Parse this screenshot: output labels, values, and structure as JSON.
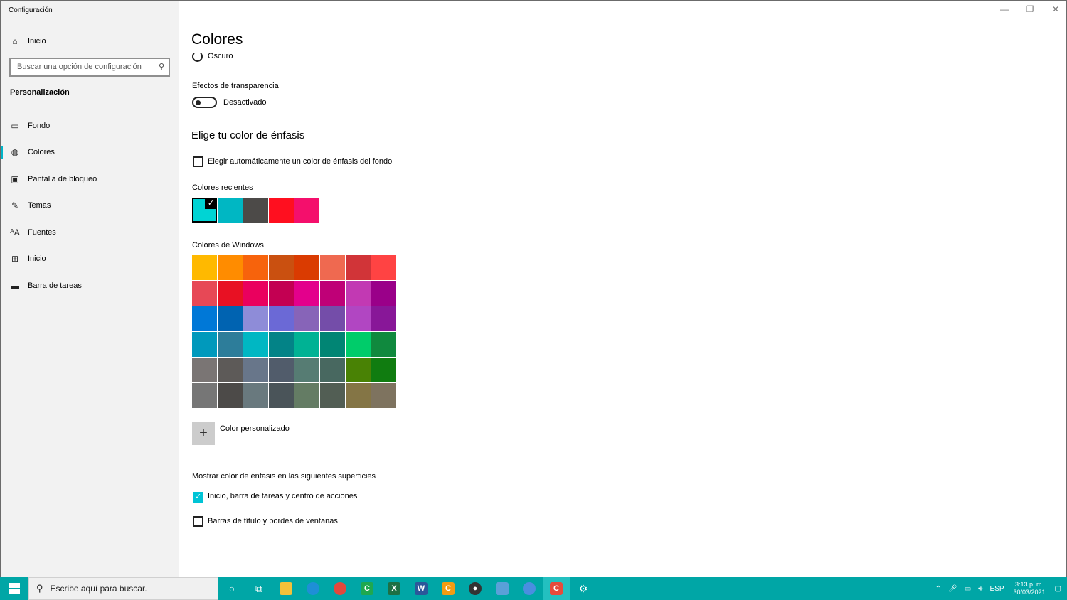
{
  "window": {
    "title": "Configuración"
  },
  "sidebar": {
    "home_label": "Inicio",
    "search_placeholder": "Buscar una opción de configuración",
    "section_title": "Personalización",
    "items": [
      {
        "label": "Fondo",
        "icon": "image-icon"
      },
      {
        "label": "Colores",
        "icon": "palette-icon",
        "selected": true
      },
      {
        "label": "Pantalla de bloqueo",
        "icon": "lock-screen-icon"
      },
      {
        "label": "Temas",
        "icon": "themes-icon"
      },
      {
        "label": "Fuentes",
        "icon": "fonts-icon"
      },
      {
        "label": "Inicio",
        "icon": "start-icon"
      },
      {
        "label": "Barra de tareas",
        "icon": "taskbar-icon"
      }
    ]
  },
  "main": {
    "title": "Colores",
    "dark_option_label": "Oscuro",
    "transparency": {
      "label": "Efectos de transparencia",
      "state_text": "Desactivado",
      "on": false
    },
    "accent_heading": "Elige tu color de énfasis",
    "auto_accent_label": "Elegir automáticamente un color de énfasis del fondo",
    "recent_colors_label": "Colores recientes",
    "recent_colors": [
      "#00d4d4",
      "#00b7c3",
      "#4c4a48",
      "#ff0f1f",
      "#f40f6c"
    ],
    "windows_colors_label": "Colores de Windows",
    "windows_colors": [
      "#ffb900",
      "#ff8c00",
      "#f7630c",
      "#ca5010",
      "#da3b01",
      "#ef6950",
      "#d13438",
      "#ff4343",
      "#e74856",
      "#e81123",
      "#ea005e",
      "#c30052",
      "#e3008c",
      "#bf0077",
      "#c239b3",
      "#9a0089",
      "#0078d7",
      "#0063b1",
      "#8e8cd8",
      "#6b69d6",
      "#8764b8",
      "#744da9",
      "#b146c2",
      "#881798",
      "#0099bc",
      "#2d7d9a",
      "#00b7c3",
      "#038387",
      "#00b294",
      "#018574",
      "#00cc6a",
      "#10893e",
      "#7a7574",
      "#5d5a58",
      "#68768a",
      "#515c6b",
      "#567c73",
      "#486860",
      "#498205",
      "#107c10",
      "#767676",
      "#4c4a48",
      "#69797e",
      "#4a5459",
      "#647c64",
      "#525e54",
      "#847545",
      "#7e735f"
    ],
    "custom_color_label": "Color personalizado",
    "surfaces_label": "Mostrar color de énfasis en las siguientes superficies",
    "surface_start_label": "Inicio, barra de tareas y centro de acciones",
    "surface_titlebars_label": "Barras de título y bordes de ventanas"
  },
  "taskbar": {
    "search_placeholder": "Escribe aquí para buscar.",
    "language": "ESP",
    "time": "3:13 p. m.",
    "date": "30/03/2021"
  }
}
